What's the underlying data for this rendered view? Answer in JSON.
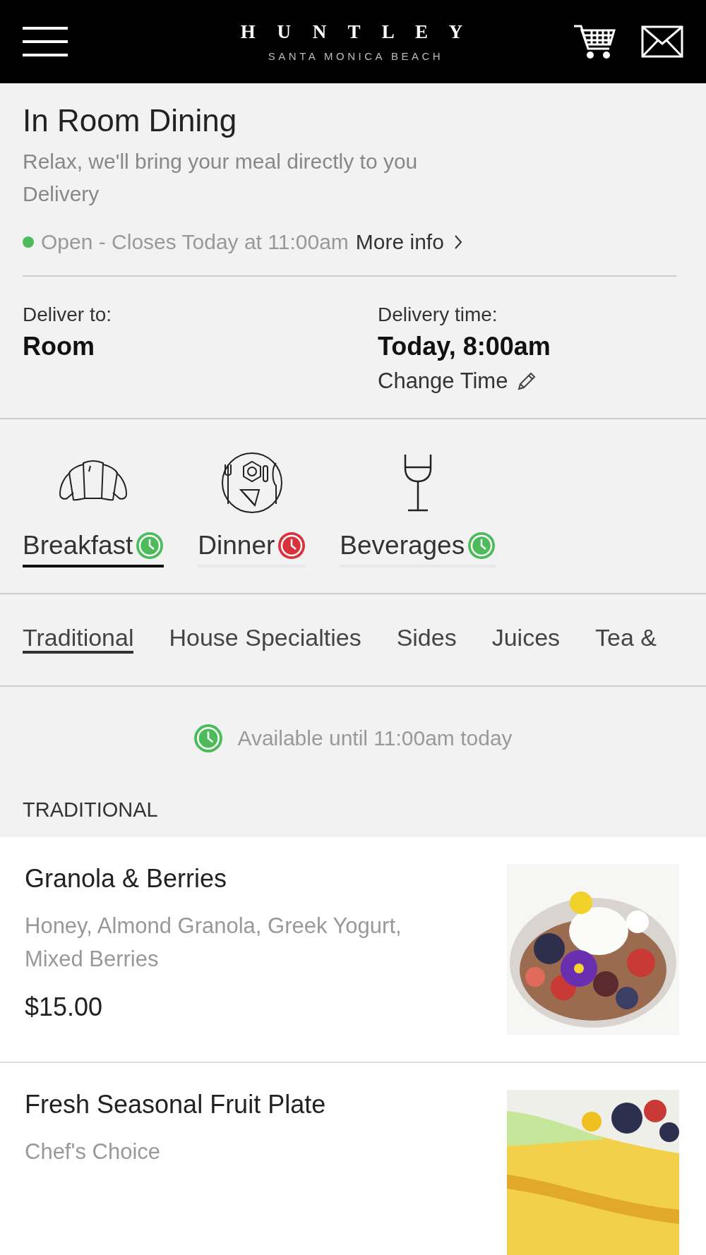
{
  "header": {
    "brand": "H U N T L E Y",
    "tagline": "SANTA MONICA BEACH"
  },
  "venue": {
    "title": "In Room Dining",
    "subtitle": "Relax, we'll bring your meal directly to you",
    "mode": "Delivery",
    "open": true,
    "status": "Open - Closes Today at 11:00am",
    "more_info": "More info"
  },
  "delivery": {
    "to_label": "Deliver to:",
    "to_value": "Room",
    "time_label": "Delivery time:",
    "time_value": "Today, 8:00am",
    "change": "Change Time"
  },
  "meal_tabs": [
    {
      "label": "Breakfast",
      "selected": true,
      "available": true
    },
    {
      "label": "Dinner",
      "selected": false,
      "available": false
    },
    {
      "label": "Beverages",
      "selected": false,
      "available": true
    }
  ],
  "category_tabs": [
    {
      "label": "Traditional",
      "selected": true
    },
    {
      "label": "House Specialties",
      "selected": false
    },
    {
      "label": "Sides",
      "selected": false
    },
    {
      "label": "Juices",
      "selected": false
    },
    {
      "label": "Tea &",
      "selected": false
    }
  ],
  "availability": "Available until 11:00am today",
  "section_heading": "TRADITIONAL",
  "items": [
    {
      "name": "Granola & Berries",
      "description": "Honey, Almond Granola, Greek Yogurt, Mixed Berries",
      "price": "$15.00"
    },
    {
      "name": "Fresh Seasonal Fruit Plate",
      "description": "Chef's Choice"
    }
  ]
}
